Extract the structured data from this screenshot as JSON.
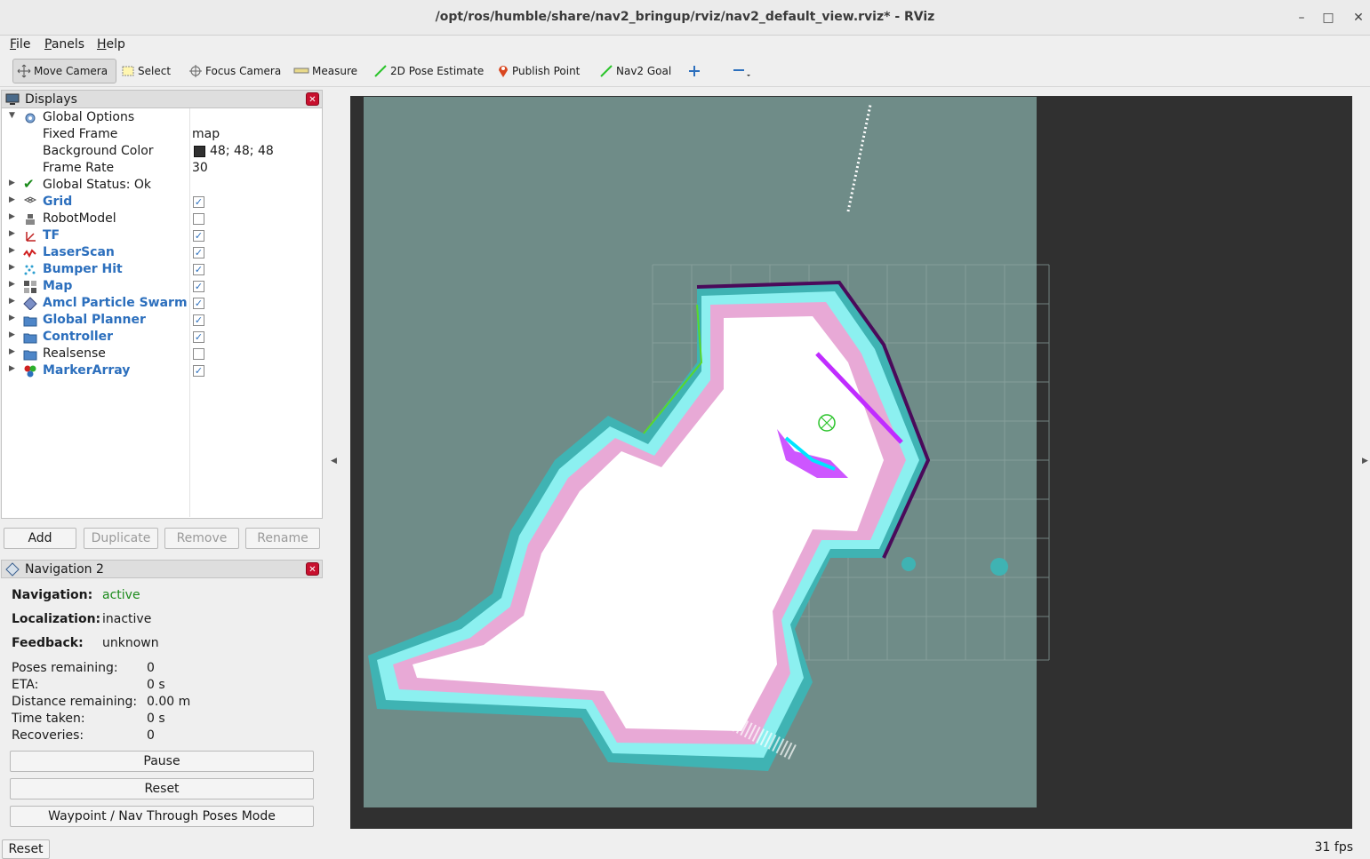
{
  "window": {
    "title": "/opt/ros/humble/share/nav2_bringup/rviz/nav2_default_view.rviz* - RViz"
  },
  "menu": [
    "File",
    "Panels",
    "Help"
  ],
  "toolbar": {
    "tools": [
      {
        "label": "Move Camera",
        "icon": "move-camera-icon"
      },
      {
        "label": "Select",
        "icon": "select-icon"
      },
      {
        "label": "Focus Camera",
        "icon": "focus-camera-icon"
      },
      {
        "label": "Measure",
        "icon": "measure-icon"
      },
      {
        "label": "2D Pose Estimate",
        "icon": "pose-estimate-icon"
      },
      {
        "label": "Publish Point",
        "icon": "map-pin-icon"
      },
      {
        "label": "Nav2 Goal",
        "icon": "nav2-goal-icon"
      }
    ]
  },
  "displays": {
    "title": "Displays",
    "global_options": {
      "label": "Global Options",
      "props": [
        {
          "name": "Fixed Frame",
          "value": "map"
        },
        {
          "name": "Background Color",
          "value": "48; 48; 48"
        },
        {
          "name": "Frame Rate",
          "value": "30"
        }
      ]
    },
    "global_status": "Global Status: Ok",
    "items": [
      {
        "label": "Grid",
        "checked": true,
        "bold": true,
        "icon": "grid-icon"
      },
      {
        "label": "RobotModel",
        "checked": false,
        "bold": false,
        "icon": "robot-model-icon"
      },
      {
        "label": "TF",
        "checked": true,
        "bold": true,
        "icon": "tf-axes-icon"
      },
      {
        "label": "LaserScan",
        "checked": true,
        "bold": true,
        "icon": "laserscan-icon"
      },
      {
        "label": "Bumper Hit",
        "checked": true,
        "bold": true,
        "icon": "bumper-hit-icon"
      },
      {
        "label": "Map",
        "checked": true,
        "bold": true,
        "icon": "map-icon"
      },
      {
        "label": "Amcl Particle Swarm",
        "checked": true,
        "bold": true,
        "icon": "particle-swarm-icon"
      },
      {
        "label": "Global Planner",
        "checked": true,
        "bold": true,
        "icon": "folder-icon"
      },
      {
        "label": "Controller",
        "checked": true,
        "bold": true,
        "icon": "folder-icon"
      },
      {
        "label": "Realsense",
        "checked": false,
        "bold": false,
        "icon": "folder-icon"
      },
      {
        "label": "MarkerArray",
        "checked": true,
        "bold": true,
        "icon": "marker-array-icon"
      }
    ],
    "buttons": {
      "add": "Add",
      "duplicate": "Duplicate",
      "remove": "Remove",
      "rename": "Rename"
    }
  },
  "navigation": {
    "title": "Navigation 2",
    "status": [
      {
        "label": "Navigation:",
        "value": "active",
        "color": "#1a8a1a"
      },
      {
        "label": "Localization:",
        "value": "inactive",
        "color": "#1a1a1a"
      },
      {
        "label": "Feedback:",
        "value": "unknown",
        "color": "#1a1a1a"
      }
    ],
    "metrics": [
      {
        "label": "Poses remaining:",
        "value": "0"
      },
      {
        "label": "ETA:",
        "value": "0 s"
      },
      {
        "label": "Distance remaining:",
        "value": "0.00 m"
      },
      {
        "label": "Time taken:",
        "value": "0 s"
      },
      {
        "label": "Recoveries:",
        "value": "0"
      }
    ],
    "buttons": {
      "pause": "Pause",
      "reset": "Reset",
      "mode": "Waypoint / Nav Through Poses Mode"
    }
  },
  "status_bar": {
    "reset": "Reset",
    "fps": "31 fps"
  },
  "colors": {
    "background": "#303030",
    "map_unknown": "#6f8c88",
    "inflation": "#e8a9d6",
    "costmap_edge": "#8cf0f0",
    "wall": "#4a0a5a",
    "link": "#2c6fbd",
    "active": "#1a8a1a"
  }
}
